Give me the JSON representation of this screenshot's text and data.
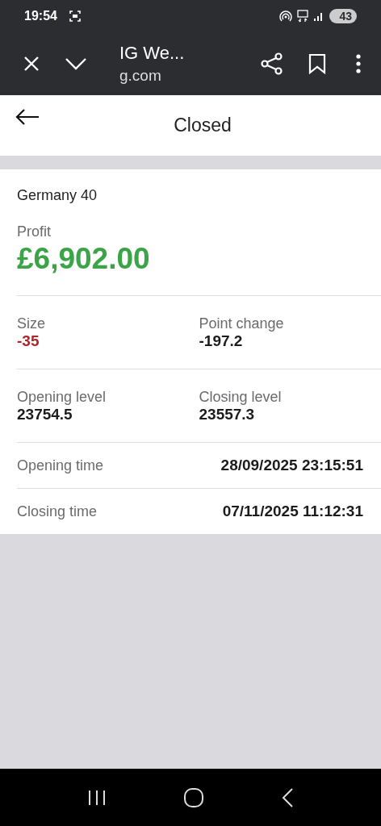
{
  "status_bar": {
    "time": "19:54",
    "battery": "43"
  },
  "browser_bar": {
    "title": "IG We...",
    "url": "g.com"
  },
  "header": {
    "title": "Closed"
  },
  "position": {
    "market": "Germany 40",
    "profit_label": "Profit",
    "profit": {
      "value": "£6,902.00",
      "color": "#3aa447"
    },
    "pairs": [
      {
        "label": "Size",
        "value": "-35",
        "color": "#b0242a"
      },
      {
        "label": "Point change",
        "value": "-197.2",
        "color": "#1c1c1c"
      },
      {
        "label": "Opening level",
        "value": "23754.5",
        "color": "#1c1c1c"
      },
      {
        "label": "Closing level",
        "value": "23557.3",
        "color": "#1c1c1c"
      }
    ],
    "times": [
      {
        "label": "Opening time",
        "value": "28/09/2025 23:15:51"
      },
      {
        "label": "Closing time",
        "value": "07/11/2025 11:12:31"
      }
    ]
  }
}
